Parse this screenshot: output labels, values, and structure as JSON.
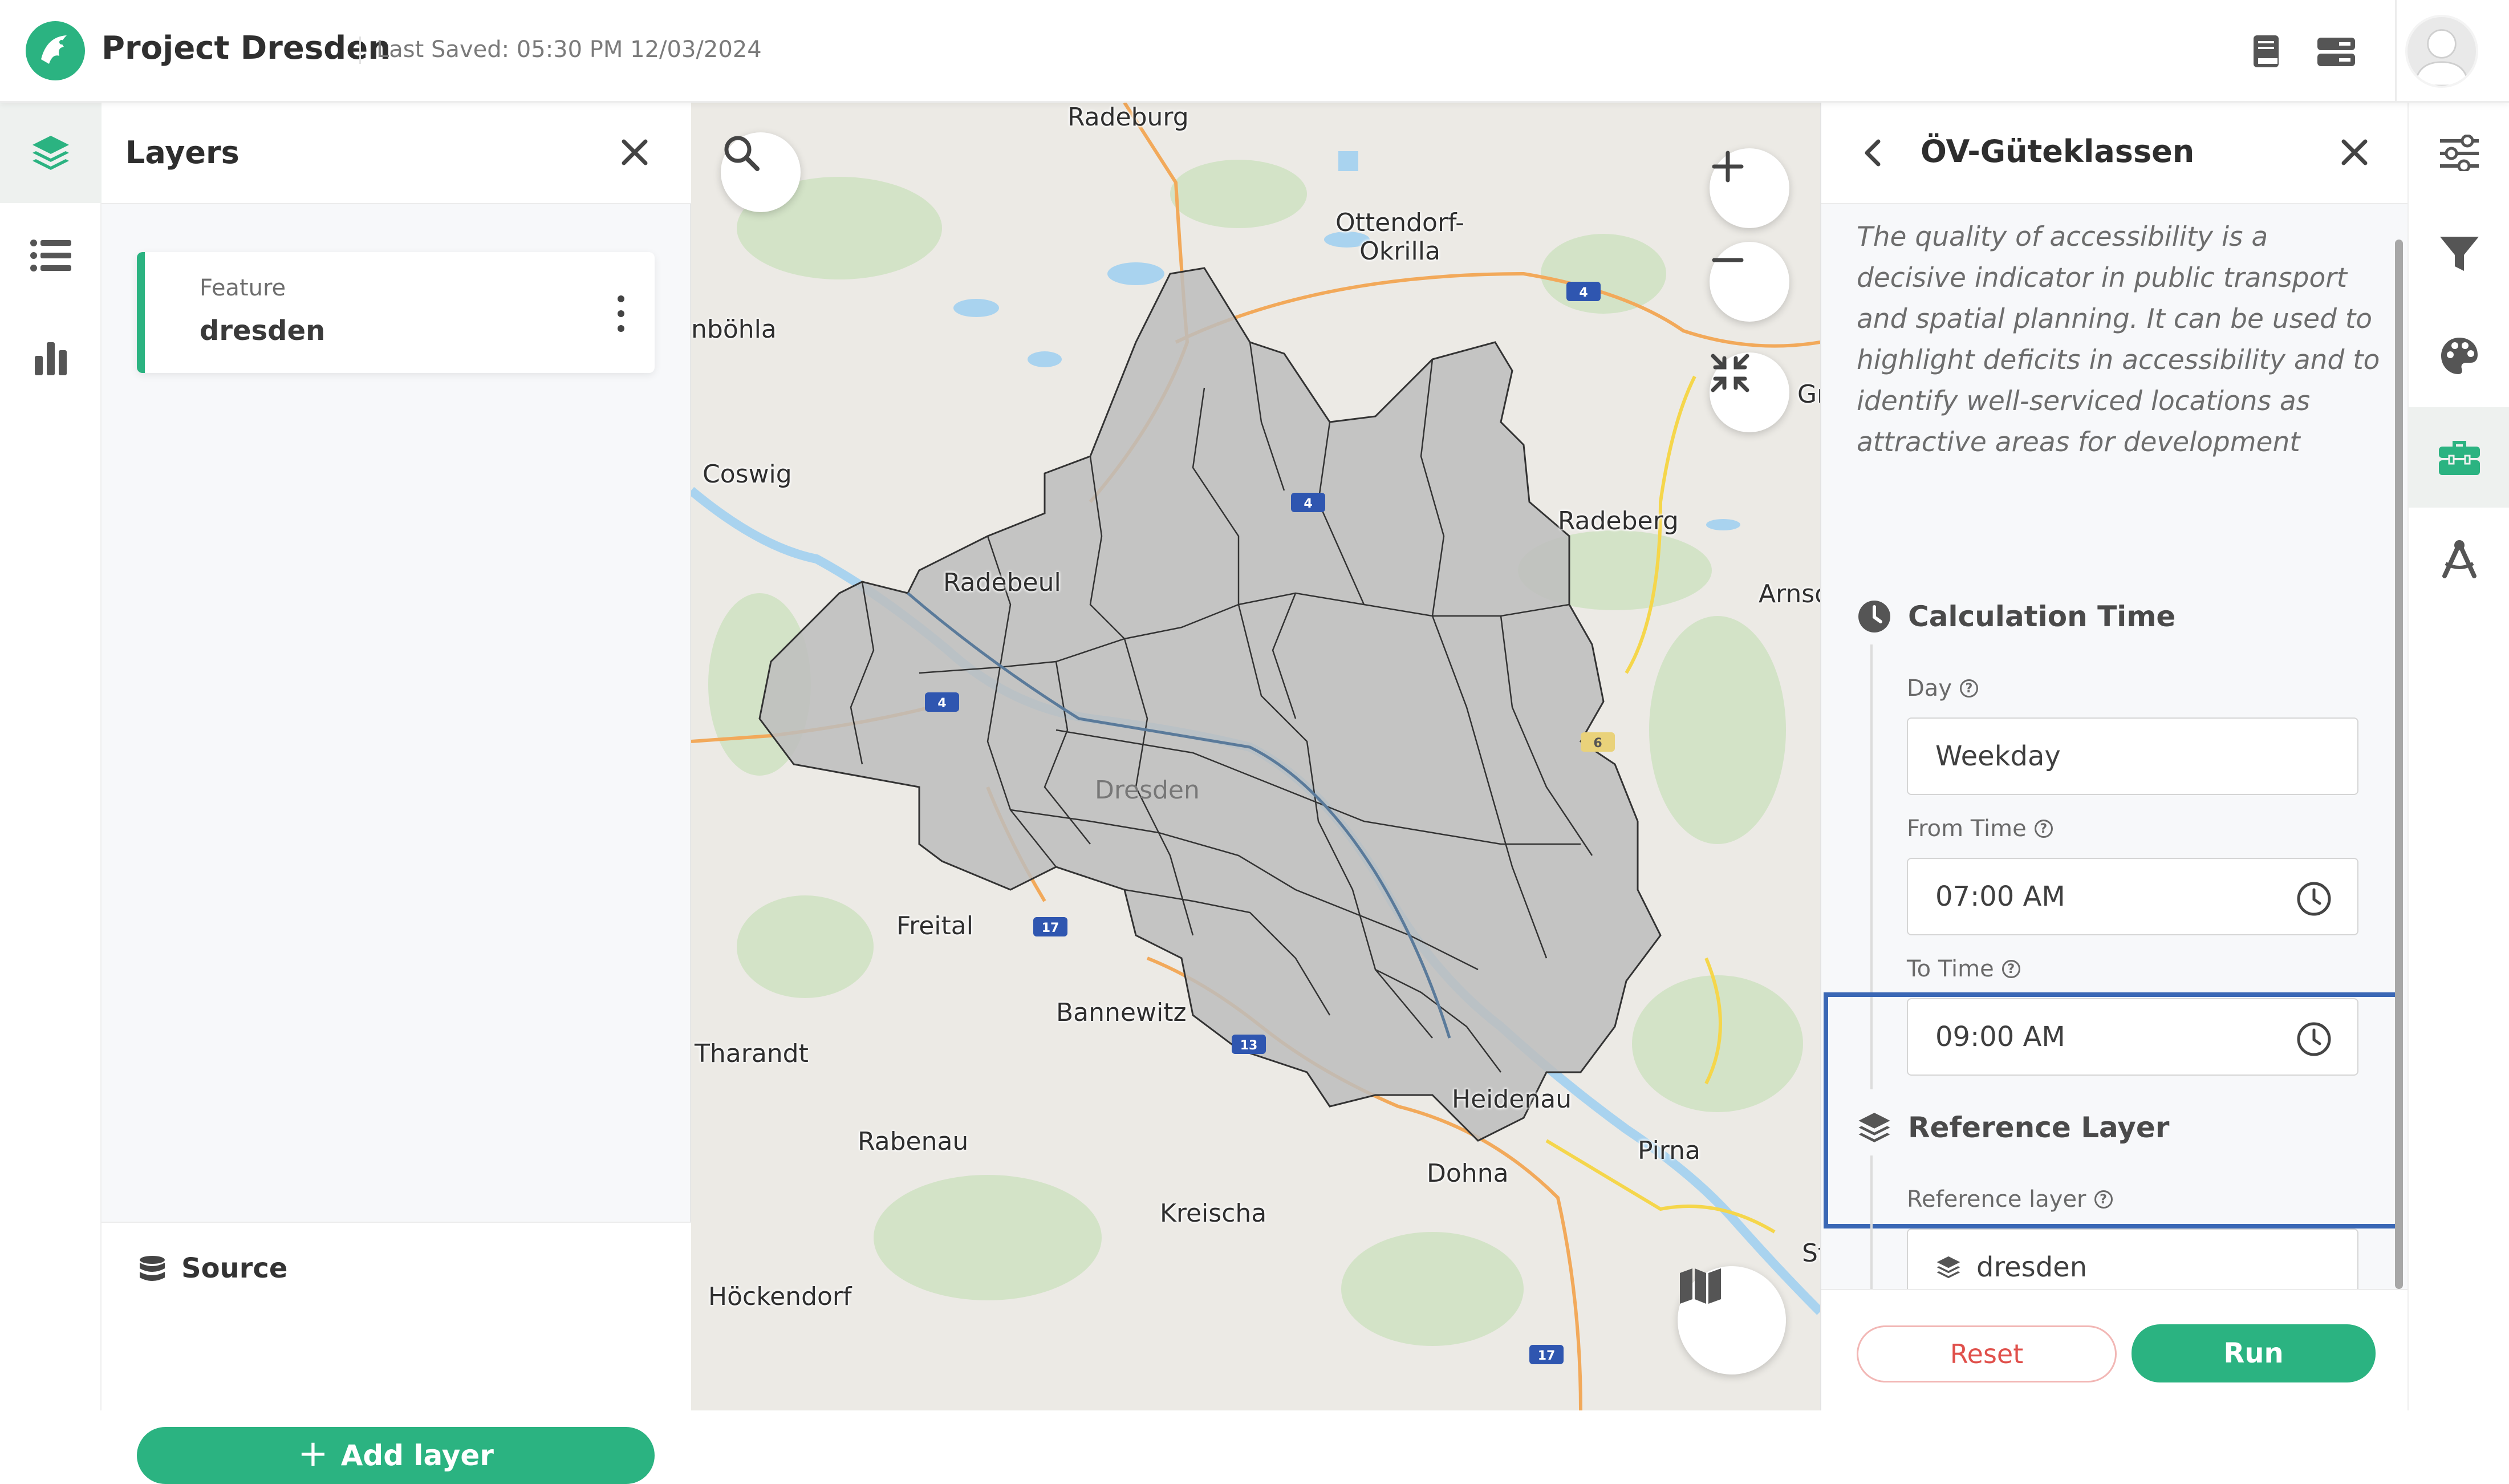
{
  "header": {
    "project_title": "Project Dresden",
    "last_saved": "Last Saved: 05:30 PM 12/03/2024"
  },
  "left_rail": {
    "items": [
      {
        "icon": "layers-icon",
        "active": true
      },
      {
        "icon": "list-icon",
        "active": false
      },
      {
        "icon": "bar-chart-icon",
        "active": false
      }
    ]
  },
  "layers_panel": {
    "title": "Layers",
    "layers": [
      {
        "type": "Feature",
        "name": "dresden"
      }
    ],
    "source_label": "Source",
    "add_layer_label": "Add layer"
  },
  "map": {
    "place_labels": [
      "Radeburg",
      "Ottendorf-\nOkrilla",
      "nböhla",
      "Coswig",
      "Radebeul",
      "Radeberg",
      "Arnsd",
      "Dresden",
      "Freital",
      "Bannewitz",
      "Tharandt",
      "Heidenau",
      "Rabenau",
      "Pirna",
      "Dohna",
      "Kreischa",
      "Höckendorf",
      "Gr",
      "St"
    ],
    "road_shields": [
      "4",
      "4",
      "4",
      "6",
      "17",
      "13",
      "17"
    ]
  },
  "tool_panel": {
    "title": "ÖV-Güteklassen",
    "description": "The quality of accessibility is a decisive indicator in public transport and spatial planning. It can be used to highlight deficits in accessibility and to identify well-serviced locations as attractive areas for development",
    "calculation_time": {
      "heading": "Calculation Time",
      "day_label": "Day",
      "day_value": "Weekday",
      "from_label": "From Time",
      "from_value": "07:00 AM",
      "to_label": "To Time",
      "to_value": "09:00 AM"
    },
    "reference_layer": {
      "heading": "Reference Layer",
      "label": "Reference layer",
      "value": "dresden"
    },
    "reset_label": "Reset",
    "run_label": "Run"
  },
  "right_rail": {
    "items": [
      {
        "icon": "sliders-icon",
        "active": false
      },
      {
        "icon": "filter-icon",
        "active": false
      },
      {
        "icon": "palette-icon",
        "active": false
      },
      {
        "icon": "toolbox-icon",
        "active": true
      },
      {
        "icon": "scenario-icon",
        "active": false
      }
    ]
  },
  "colors": {
    "accent": "#2bb381",
    "highlight": "#3a67b5",
    "reset": "#e0504b"
  }
}
